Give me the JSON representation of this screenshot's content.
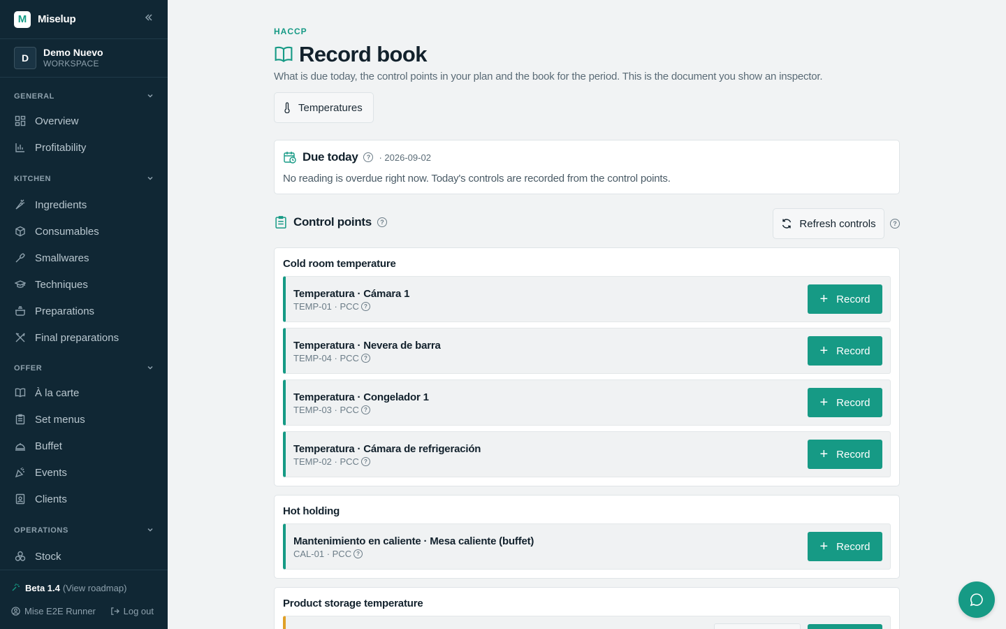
{
  "brand": {
    "logo_letter": "M",
    "name": "Miselup"
  },
  "workspace": {
    "avatar_letter": "D",
    "name": "Demo Nuevo",
    "label": "WORKSPACE"
  },
  "nav": {
    "general": {
      "label": "GENERAL",
      "items": [
        {
          "label": "Overview",
          "icon": "grid-icon"
        },
        {
          "label": "Profitability",
          "icon": "bar-chart-icon"
        }
      ]
    },
    "kitchen": {
      "label": "KITCHEN",
      "items": [
        {
          "label": "Ingredients",
          "icon": "carrot-icon"
        },
        {
          "label": "Consumables",
          "icon": "box-icon"
        },
        {
          "label": "Smallwares",
          "icon": "utensil-icon"
        },
        {
          "label": "Techniques",
          "icon": "graduation-cap-icon"
        },
        {
          "label": "Preparations",
          "icon": "pot-icon"
        },
        {
          "label": "Final preparations",
          "icon": "cutlery-icon"
        }
      ]
    },
    "offer": {
      "label": "OFFER",
      "items": [
        {
          "label": "À la carte",
          "icon": "book-icon"
        },
        {
          "label": "Set menus",
          "icon": "clipboard-icon"
        },
        {
          "label": "Buffet",
          "icon": "cloche-icon"
        },
        {
          "label": "Events",
          "icon": "party-icon"
        },
        {
          "label": "Clients",
          "icon": "contact-icon"
        }
      ]
    },
    "operations": {
      "label": "OPERATIONS",
      "items": [
        {
          "label": "Stock",
          "icon": "boxes-icon"
        }
      ]
    }
  },
  "footer": {
    "beta": "Beta 1.4",
    "roadmap": "(View roadmap)",
    "user": "Mise E2E Runner",
    "logout": "Log out"
  },
  "page": {
    "eyebrow": "HACCP",
    "title": "Record book",
    "subtitle": "What is due today, the control points in your plan and the book for the period. This is the document you show an inspector.",
    "filter_chip": "Temperatures"
  },
  "due_today": {
    "title": "Due today",
    "date": "· 2026-09-02",
    "message": "No reading is overdue right now. Today's controls are recorded from the control points."
  },
  "control_points": {
    "title": "Control points",
    "refresh_label": "Refresh controls",
    "record_label": "Record",
    "groups": [
      {
        "title": "Cold room temperature",
        "rows": [
          {
            "name": "Temperatura · Cámara 1",
            "meta": "TEMP-01 · PCC"
          },
          {
            "name": "Temperatura · Nevera de barra",
            "meta": "TEMP-04 · PCC"
          },
          {
            "name": "Temperatura · Congelador 1",
            "meta": "TEMP-03 · PCC"
          },
          {
            "name": "Temperatura · Cámara de refrigeración",
            "meta": "TEMP-02 · PCC"
          }
        ]
      },
      {
        "title": "Hot holding",
        "rows": [
          {
            "name": "Mantenimiento en caliente · Mesa caliente (buffet)",
            "meta": "CAL-01 · PCC"
          }
        ]
      },
      {
        "title": "Product storage temperature",
        "rows": []
      }
    ]
  },
  "colors": {
    "sidebar_bg": "#102734",
    "accent": "#169a85",
    "warning": "#e0a028"
  }
}
